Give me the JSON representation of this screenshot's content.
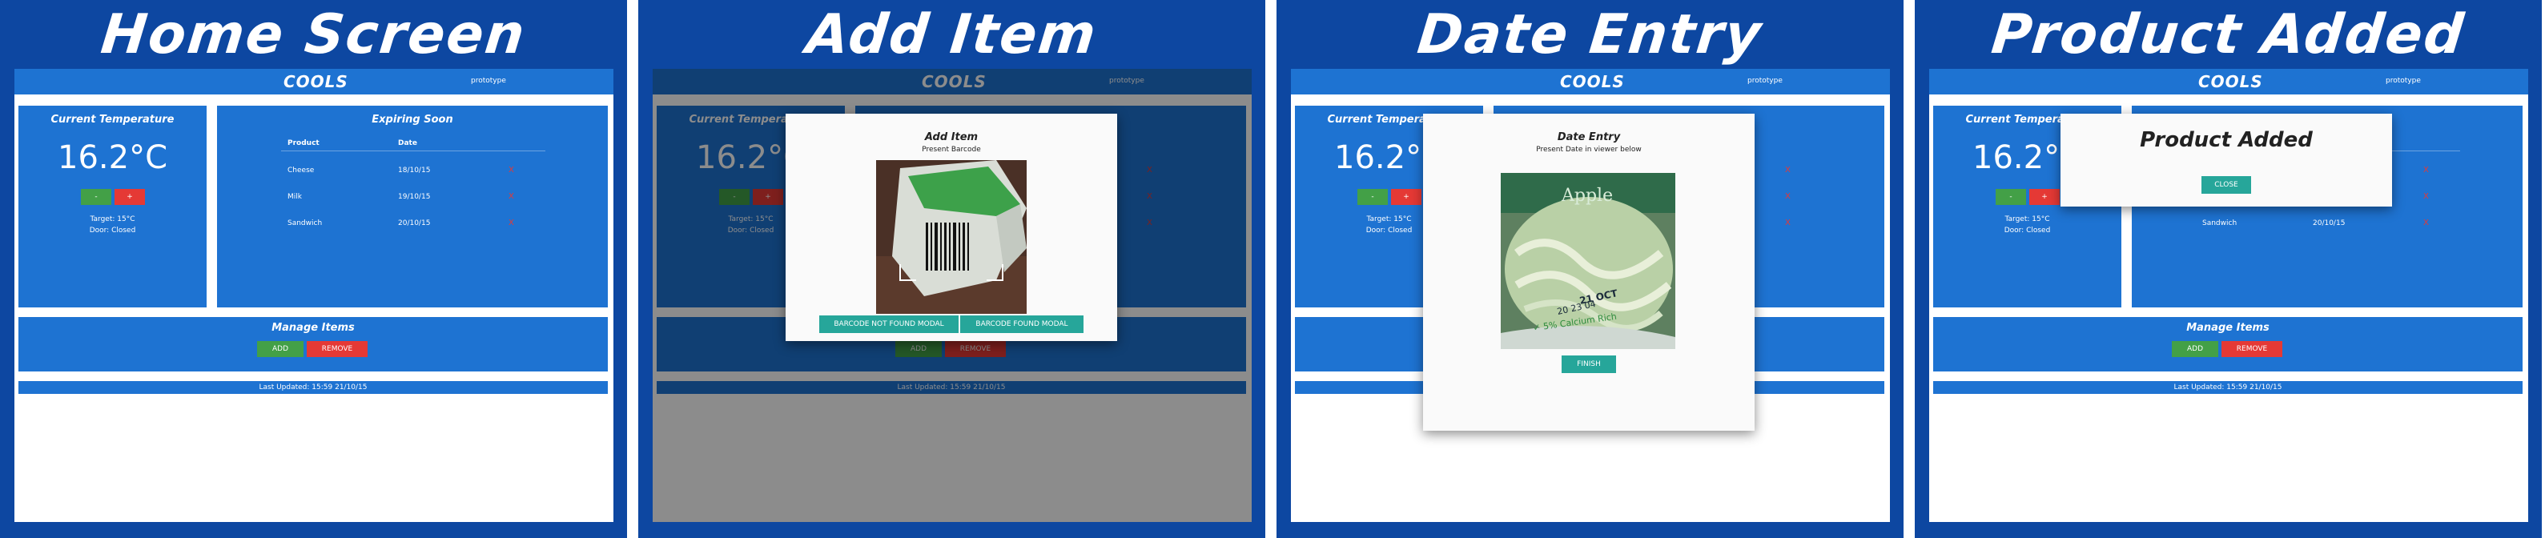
{
  "panels": [
    {
      "heading": "Home Screen"
    },
    {
      "heading": "Add Item"
    },
    {
      "heading": "Date Entry"
    },
    {
      "heading": "Product Added"
    }
  ],
  "app": {
    "logo": "COOLS",
    "tagline": "prototype"
  },
  "temperature": {
    "title": "Current Temperature",
    "value": "16.2°C",
    "minus_label": "-",
    "plus_label": "+",
    "target": "Target: 15°C",
    "door": "Door: Closed"
  },
  "expiring": {
    "title": "Expiring Soon",
    "headers": {
      "product": "Product",
      "date": "Date"
    },
    "rows": [
      {
        "product": "Cheese",
        "date": "18/10/15",
        "remove": "X"
      },
      {
        "product": "Milk",
        "date": "19/10/15",
        "remove": "X"
      },
      {
        "product": "Sandwich",
        "date": "20/10/15",
        "remove": "X"
      }
    ]
  },
  "manage": {
    "title": "Manage Items",
    "add_label": "ADD",
    "remove_label": "REMOVE"
  },
  "status": {
    "last_updated": "Last Updated: 15:59 21/10/15"
  },
  "add_item_modal": {
    "title": "Add Item",
    "subtitle": "Present Barcode",
    "not_found_label": "BARCODE NOT FOUND MODAL",
    "found_label": "BARCODE FOUND MODAL"
  },
  "date_modal": {
    "title": "Date Entry",
    "subtitle": "Present Date in viewer below",
    "finish_label": "FINISH",
    "photo_text_brand": "Apple",
    "photo_text_date": "21 OCT",
    "photo_text_line2": "20 23 04",
    "photo_text_check": "✓ 5% Calcium Rich"
  },
  "added_modal": {
    "title": "Product Added",
    "close_label": "CLOSE"
  },
  "colors": {
    "frame": "#0d47a1",
    "card": "#1e73d2",
    "add": "#43a047",
    "remove": "#e53935",
    "teal": "#26a69a"
  }
}
